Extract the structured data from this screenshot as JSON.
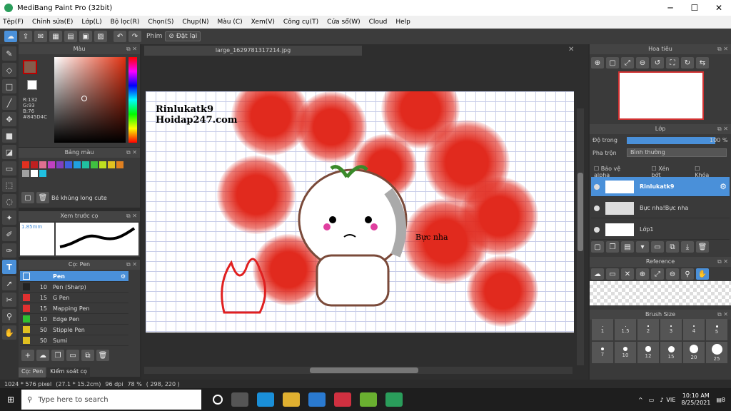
{
  "window": {
    "title": "MediBang Paint Pro (32bit)",
    "controls": [
      "─",
      "☐",
      "✕"
    ]
  },
  "menu": [
    "Tệp(F)",
    "Chỉnh sửa(E)",
    "Lớp(L)",
    "Bộ lọc(R)",
    "Chọn(S)",
    "Chụp(N)",
    "Màu (C)",
    "Xem(V)",
    "Công cụ(T)",
    "Cửa sổ(W)",
    "Cloud",
    "Help"
  ],
  "toolbar": {
    "label_key": "Phím",
    "reset_label": "Đặt lại"
  },
  "color_panel": {
    "title": "Màu",
    "rgb_r": "R:132",
    "rgb_g": "G:93",
    "rgb_b": "B:76",
    "hex": "#845D4C",
    "main_color": "#845d4c"
  },
  "palette_panel": {
    "title": "Bảng màu",
    "swatches": [
      "#e03020",
      "#c02020",
      "#e07090",
      "#c040c0",
      "#8040c0",
      "#4060e0",
      "#20a0e0",
      "#20c0a0",
      "#40c040",
      "#c0e020",
      "#e0c020",
      "#e08020",
      "#a0a0a0",
      "#ffffff",
      "#20c0e0"
    ],
    "palette_name": "Bé khủng long cute"
  },
  "brush_preview": {
    "title": "Xem trước cọ",
    "size": "1.85mm"
  },
  "brush_panel": {
    "title": "Cọ: Pen",
    "items": [
      {
        "size": "",
        "name": "Pen",
        "color": "#4a90d9"
      },
      {
        "size": "10",
        "name": "Pen (Sharp)",
        "color": "#222222"
      },
      {
        "size": "15",
        "name": "G Pen",
        "color": "#e03030"
      },
      {
        "size": "15",
        "name": "Mapping Pen",
        "color": "#e03030"
      },
      {
        "size": "10",
        "name": "Edge Pen",
        "color": "#30c030"
      },
      {
        "size": "50",
        "name": "Stipple Pen",
        "color": "#e0c020"
      },
      {
        "size": "50",
        "name": "Sumi",
        "color": "#e0c020"
      }
    ],
    "tabs": [
      "Cọ: Pen",
      "Kiểm soát cọ"
    ]
  },
  "canvas": {
    "tab_title": "large_1629781317214.jpg",
    "text_line1": "Rinlukatk9",
    "text_line2": "Hoidap247.com",
    "text_bubble": "Bực nha"
  },
  "navigator": {
    "title": "Hoa tiêu"
  },
  "layer_panel": {
    "title": "Lớp",
    "opacity_label": "Độ trong",
    "opacity_value": "100 %",
    "opacity_fraction": 1.0,
    "blend_label": "Pha trộn",
    "blend_value": "Bình thường",
    "check_alpha": "Bảo vệ alpha",
    "check_clip": "Xén bớt",
    "check_lock": "Khóa",
    "layers": [
      "Rinlukatk9",
      "Bực nha!Bực nha",
      "Lớp1"
    ]
  },
  "reference": {
    "title": "Reference"
  },
  "brush_size": {
    "title": "Brush Size",
    "sizes": [
      "1",
      "1.5",
      "2",
      "3",
      "4",
      "5",
      "7",
      "10",
      "12",
      "15",
      "20",
      "25"
    ]
  },
  "status": {
    "dims": "1024 * 576 pixel",
    "cm": "(27.1 * 15.2cm)",
    "dpi": "96 dpi",
    "zoom": "78 %",
    "coords": "( 298, 220 )"
  },
  "taskbar": {
    "search_placeholder": "Type here to search",
    "lang": "VIE",
    "time": "10:10 AM",
    "date": "8/25/2021",
    "notif_count": "8"
  }
}
